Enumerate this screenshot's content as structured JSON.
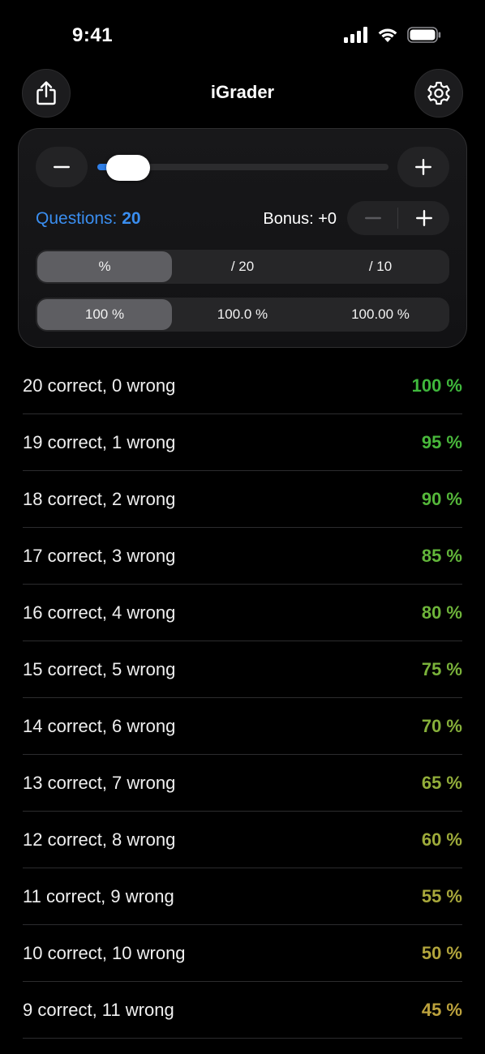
{
  "status_bar": {
    "time": "9:41",
    "icons": [
      "cellular-signal-icon",
      "wifi-icon",
      "battery-icon"
    ]
  },
  "header": {
    "title": "iGrader",
    "share_icon": "share-icon",
    "settings_icon": "gear-icon"
  },
  "controls": {
    "slider_min_icon": "minus-icon",
    "slider_max_icon": "plus-icon",
    "slider_fraction": 0.03,
    "questions_prefix": "Questions: ",
    "questions_value": "20",
    "bonus_text": "Bonus: +0",
    "format_options": [
      {
        "label": "%",
        "selected": true
      },
      {
        "label": "/ 20",
        "selected": false
      },
      {
        "label": "/ 10",
        "selected": false
      }
    ],
    "precision_options": [
      {
        "label": "100 %",
        "selected": true
      },
      {
        "label": "100.0 %",
        "selected": false
      },
      {
        "label": "100.00 %",
        "selected": false
      }
    ]
  },
  "colors": {
    "accent": "#3a8ef0",
    "slider_fill": "#2f7fe8"
  },
  "results": [
    {
      "label": "20 correct, 0 wrong",
      "value": "100 %",
      "color": "#3fb83c"
    },
    {
      "label": "19 correct, 1 wrong",
      "value": "95 %",
      "color": "#49b83b"
    },
    {
      "label": "18 correct, 2 wrong",
      "value": "90 %",
      "color": "#55b73a"
    },
    {
      "label": "17 correct, 3 wrong",
      "value": "85 %",
      "color": "#62b63a"
    },
    {
      "label": "16 correct, 4 wrong",
      "value": "80 %",
      "color": "#6eb43a"
    },
    {
      "label": "15 correct, 5 wrong",
      "value": "75 %",
      "color": "#7ab23a"
    },
    {
      "label": "14 correct, 6 wrong",
      "value": "70 %",
      "color": "#86b03a"
    },
    {
      "label": "13 correct, 7 wrong",
      "value": "65 %",
      "color": "#92ae3a"
    },
    {
      "label": "12 correct, 8 wrong",
      "value": "60 %",
      "color": "#9eab3a"
    },
    {
      "label": "11 correct, 9 wrong",
      "value": "55 %",
      "color": "#a8a83b"
    },
    {
      "label": "10 correct, 10 wrong",
      "value": "50 %",
      "color": "#b2a53c"
    },
    {
      "label": "9 correct, 11 wrong",
      "value": "45 %",
      "color": "#bca23d"
    }
  ]
}
